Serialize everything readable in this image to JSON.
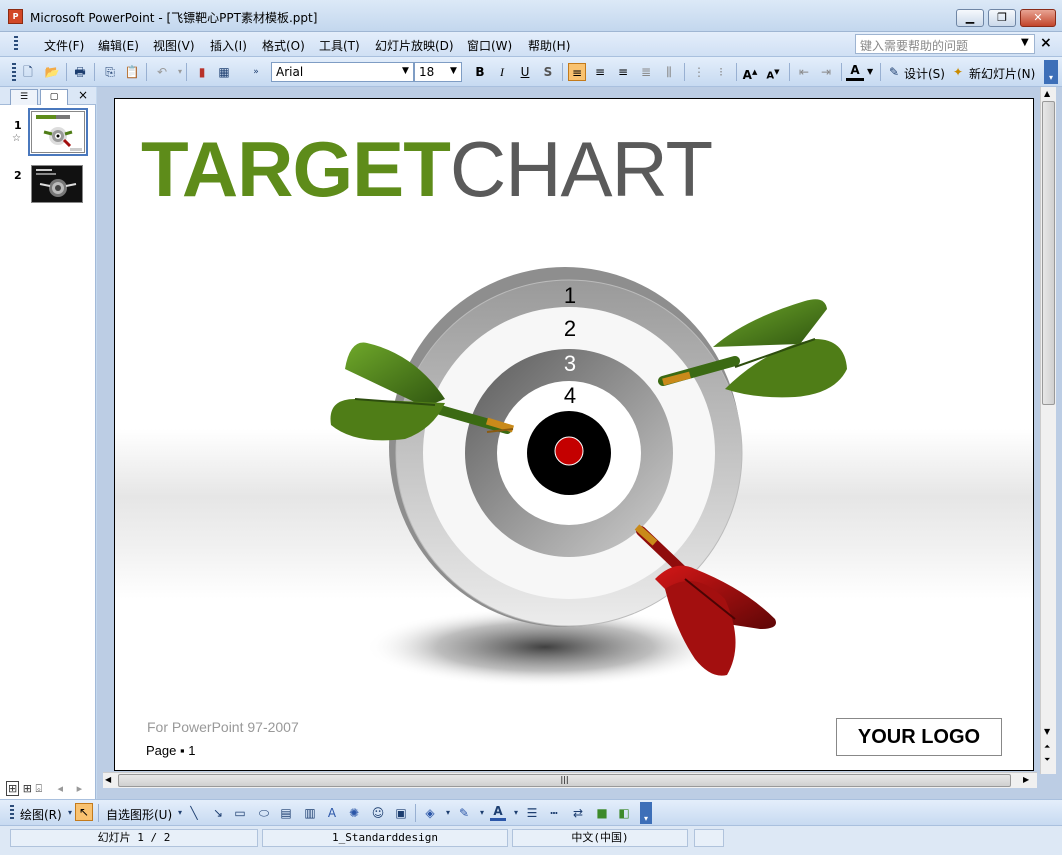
{
  "window": {
    "title": "Microsoft PowerPoint - [飞镖靶心PPT素材模板.ppt]",
    "minimize_label": "▁",
    "maximize_label": "❐",
    "close_label": "✕"
  },
  "menu": {
    "items": [
      "文件(F)",
      "编辑(E)",
      "视图(V)",
      "插入(I)",
      "格式(O)",
      "工具(T)",
      "幻灯片放映(D)",
      "窗口(W)",
      "帮助(H)"
    ],
    "help_placeholder": "键入需要帮助的问题",
    "close_label": "×"
  },
  "toolbar": {
    "font_name": "Arial",
    "font_size": "18",
    "bold": "B",
    "italic": "I",
    "underline": "U",
    "shadow": "S",
    "design_label": "设计(S)",
    "new_slide_label": "新幻灯片(N)"
  },
  "left_pane": {
    "slides": [
      {
        "number": "1",
        "has_animation": true
      },
      {
        "number": "2",
        "has_animation": false
      }
    ],
    "close_label": "×"
  },
  "slide": {
    "title_green": "TARGET",
    "title_grey": "CHART",
    "ring_labels": [
      "1",
      "2",
      "3",
      "4"
    ],
    "footer": "For PowerPoint  97-2007",
    "page_label": "Page ▪ 1",
    "logo": "YOUR LOGO"
  },
  "drawing_toolbar": {
    "draw_label": "绘图(R)",
    "autoshape_label": "自选图形(U)"
  },
  "status": {
    "slide_info": "幻灯片 1 / 2",
    "design": "1_Standarddesign",
    "language": "中文(中国)"
  },
  "colors": {
    "title_green": "#5e8c1a",
    "title_grey": "#5a5a5a",
    "dart_green": "#4f7d17",
    "dart_red": "#a30f0f",
    "bullseye": "#c40000"
  }
}
